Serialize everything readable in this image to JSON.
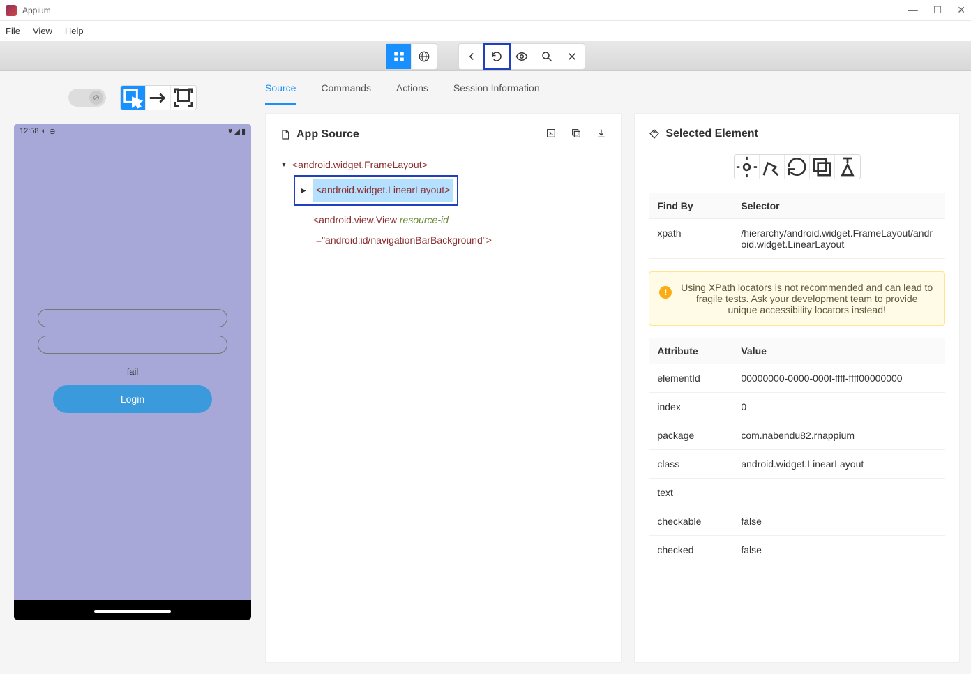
{
  "window": {
    "title": "Appium"
  },
  "menu": {
    "file": "File",
    "view": "View",
    "help": "Help"
  },
  "tabs": {
    "source": "Source",
    "commands": "Commands",
    "actions": "Actions",
    "session": "Session Information"
  },
  "source_panel": {
    "title": "App Source",
    "tree": {
      "node0": "<android.widget.FrameLayout>",
      "node1": "<android.widget.LinearLayout>",
      "node2_pre": "<android.view.View ",
      "node2_attr": "resource-id",
      "node2_post": "=\"android:id/navigationBarBackground\">"
    }
  },
  "selected_panel": {
    "title": "Selected Element",
    "findby_header": "Find By",
    "selector_header": "Selector",
    "findby_rows": [
      {
        "by": "xpath",
        "selector": "/hierarchy/android.widget.FrameLayout/android.widget.LinearLayout"
      }
    ],
    "alert": "Using XPath locators is not recommended and can lead to fragile tests. Ask your development team to provide unique accessibility locators instead!",
    "attr_header": "Attribute",
    "value_header": "Value",
    "attributes": [
      {
        "attr": "elementId",
        "value": "00000000-0000-000f-ffff-ffff00000000"
      },
      {
        "attr": "index",
        "value": "0"
      },
      {
        "attr": "package",
        "value": "com.nabendu82.rnappium"
      },
      {
        "attr": "class",
        "value": "android.widget.LinearLayout"
      },
      {
        "attr": "text",
        "value": ""
      },
      {
        "attr": "checkable",
        "value": "false"
      },
      {
        "attr": "checked",
        "value": "false"
      }
    ]
  },
  "device": {
    "time": "12:58",
    "fail": "fail",
    "login": "Login"
  }
}
